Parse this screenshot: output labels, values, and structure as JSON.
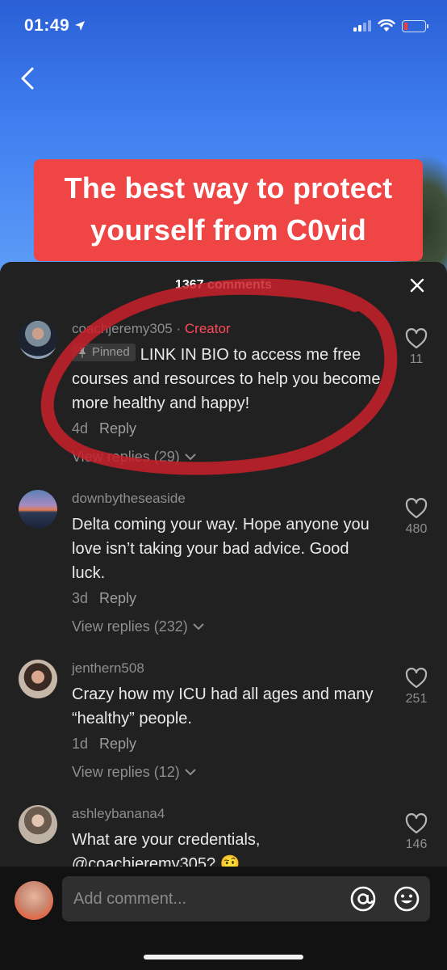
{
  "status_bar": {
    "time": "01:49"
  },
  "video": {
    "caption": "The best way to protect yourself from C0vid"
  },
  "sheet": {
    "title": "1367 comments"
  },
  "comments": [
    {
      "username": "coachjeremy305",
      "badge": "Creator",
      "pinned_label": "Pinned",
      "text": "LINK IN BIO to access me free courses and resources to help you become more healthy and happy!",
      "age": "4d",
      "reply_label": "Reply",
      "view_replies": "View replies (29)",
      "likes": "11"
    },
    {
      "username": "downbytheseaside",
      "text": "Delta coming your way. Hope anyone you love isn’t taking your bad advice. Good luck.",
      "age": "3d",
      "reply_label": "Reply",
      "view_replies": "View replies (232)",
      "likes": "480"
    },
    {
      "username": "jenthern508",
      "text": "Crazy how my ICU had all ages and many “healthy” people.",
      "age": "1d",
      "reply_label": "Reply",
      "view_replies": "View replies (12)",
      "likes": "251"
    },
    {
      "username": "ashleybanana4",
      "text": "What are your credentials, @coachjeremy305? 🤨",
      "likes": "146"
    }
  ],
  "input": {
    "placeholder": "Add comment..."
  },
  "colors": {
    "sheet_bg": "#212121",
    "creator": "#ff4a5a",
    "caption_bg": "#f04545",
    "annotation": "#c8202a"
  },
  "icons": [
    "location-arrow-icon",
    "signal-icon",
    "wifi-icon",
    "battery-icon",
    "back-chevron-icon",
    "close-icon",
    "pin-icon",
    "heart-icon",
    "chevron-down-icon",
    "at-icon",
    "emoji-icon"
  ]
}
